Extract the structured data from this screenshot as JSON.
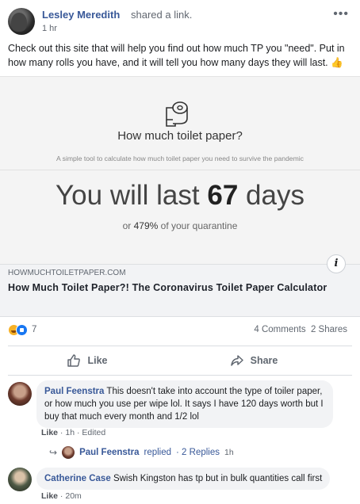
{
  "post": {
    "author": "Lesley Meredith",
    "action": "shared a link.",
    "time": "1 hr",
    "more_icon": "•••",
    "text": "Check out this site that will help you find out how much TP you \"need\". Put in how many rolls you have, and it will tell you how many days they will last. 👍"
  },
  "preview": {
    "icon": "toilet-paper-roll-icon",
    "heading": "How much toilet paper?",
    "subheading": "A simple tool to calculate how much toilet paper you need to survive the pandemic",
    "result_prefix": "You will last",
    "result_days": "67",
    "result_suffix": "days",
    "quarantine_prefix": "or",
    "quarantine_pct": "479%",
    "quarantine_suffix": "of your quarantine"
  },
  "link": {
    "info_icon": "i",
    "domain": "HOWMUCHTOILETPAPER.COM",
    "title": "How Much Toilet Paper?! The Coronavirus Toilet Paper Calculator"
  },
  "stats": {
    "reactions_count": "7",
    "comments": "4 Comments",
    "shares": "2 Shares"
  },
  "actions": {
    "like": "Like",
    "share": "Share"
  },
  "comments": [
    {
      "name": "Paul Feenstra",
      "text": "This doesn't take into account the type of toiler paper, or how much you use per wipe lol. It says I have 120 days worth but I buy that much every month and 1/2 lol",
      "like": "Like",
      "time": "1h",
      "edited": "Edited"
    },
    {
      "name": "Catherine Case",
      "text": "Swish Kingston has tp but in bulk quantities call first",
      "like": "Like",
      "time": "20m"
    }
  ],
  "reply": {
    "name": "Paul Feenstra",
    "verb": "replied",
    "count": "2 Replies",
    "time": "1h"
  },
  "colors": {
    "link_blue": "#385898",
    "like_blue": "#1877f2",
    "bubble_bg": "#f2f3f5"
  }
}
